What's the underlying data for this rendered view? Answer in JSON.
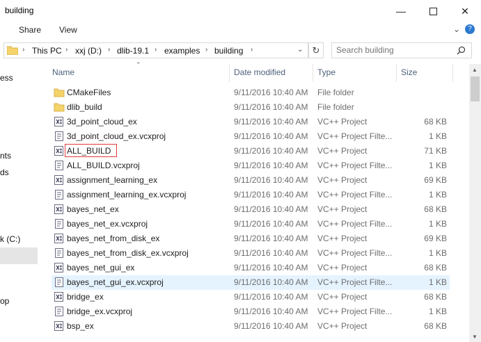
{
  "window": {
    "title": "building"
  },
  "ribbon": {
    "tabs": [
      "Share",
      "View"
    ]
  },
  "address": {
    "crumbs": [
      "This PC",
      "xxj (D:)",
      "dlib-19.1",
      "examples",
      "building"
    ]
  },
  "search": {
    "placeholder": "Search building"
  },
  "nav": {
    "items": [
      {
        "label": "ess"
      },
      {
        "label": "nts"
      },
      {
        "label": "ds"
      },
      {
        "label": "k (C:)"
      },
      {
        "label": "op"
      }
    ]
  },
  "columns": {
    "name": "Name",
    "date": "Date modified",
    "type": "Type",
    "size": "Size"
  },
  "files": [
    {
      "name": "CMakeFiles",
      "date": "9/11/2016 10:40 AM",
      "type": "File folder",
      "size": "",
      "icon": "folder-icon"
    },
    {
      "name": "dlib_build",
      "date": "9/11/2016 10:40 AM",
      "type": "File folder",
      "size": "",
      "icon": "folder-icon"
    },
    {
      "name": "3d_point_cloud_ex",
      "date": "9/11/2016 10:40 AM",
      "type": "VC++ Project",
      "size": "68 KB",
      "icon": "vcxproj-icon"
    },
    {
      "name": "3d_point_cloud_ex.vcxproj",
      "date": "9/11/2016 10:40 AM",
      "type": "VC++ Project Filte...",
      "size": "1 KB",
      "icon": "filters-icon"
    },
    {
      "name": "ALL_BUILD",
      "date": "9/11/2016 10:40 AM",
      "type": "VC++ Project",
      "size": "71 KB",
      "icon": "vcxproj-icon"
    },
    {
      "name": "ALL_BUILD.vcxproj",
      "date": "9/11/2016 10:40 AM",
      "type": "VC++ Project Filte...",
      "size": "1 KB",
      "icon": "filters-icon"
    },
    {
      "name": "assignment_learning_ex",
      "date": "9/11/2016 10:40 AM",
      "type": "VC++ Project",
      "size": "69 KB",
      "icon": "vcxproj-icon"
    },
    {
      "name": "assignment_learning_ex.vcxproj",
      "date": "9/11/2016 10:40 AM",
      "type": "VC++ Project Filte...",
      "size": "1 KB",
      "icon": "filters-icon"
    },
    {
      "name": "bayes_net_ex",
      "date": "9/11/2016 10:40 AM",
      "type": "VC++ Project",
      "size": "68 KB",
      "icon": "vcxproj-icon"
    },
    {
      "name": "bayes_net_ex.vcxproj",
      "date": "9/11/2016 10:40 AM",
      "type": "VC++ Project Filte...",
      "size": "1 KB",
      "icon": "filters-icon"
    },
    {
      "name": "bayes_net_from_disk_ex",
      "date": "9/11/2016 10:40 AM",
      "type": "VC++ Project",
      "size": "69 KB",
      "icon": "vcxproj-icon"
    },
    {
      "name": "bayes_net_from_disk_ex.vcxproj",
      "date": "9/11/2016 10:40 AM",
      "type": "VC++ Project Filte...",
      "size": "1 KB",
      "icon": "filters-icon"
    },
    {
      "name": "bayes_net_gui_ex",
      "date": "9/11/2016 10:40 AM",
      "type": "VC++ Project",
      "size": "68 KB",
      "icon": "vcxproj-icon"
    },
    {
      "name": "bayes_net_gui_ex.vcxproj",
      "date": "9/11/2016 10:40 AM",
      "type": "VC++ Project Filte...",
      "size": "1 KB",
      "icon": "filters-icon"
    },
    {
      "name": "bridge_ex",
      "date": "9/11/2016 10:40 AM",
      "type": "VC++ Project",
      "size": "68 KB",
      "icon": "vcxproj-icon"
    },
    {
      "name": "bridge_ex.vcxproj",
      "date": "9/11/2016 10:40 AM",
      "type": "VC++ Project Filte...",
      "size": "1 KB",
      "icon": "filters-icon"
    },
    {
      "name": "bsp_ex",
      "date": "9/11/2016 10:40 AM",
      "type": "VC++ Project",
      "size": "68 KB",
      "icon": "vcxproj-icon"
    }
  ],
  "state": {
    "hover_index": 13,
    "rename_index": 4
  },
  "colors": {
    "hover_row": "#e5f3ff",
    "rename_border": "#e03b3b",
    "folder": "#f4d36b"
  }
}
